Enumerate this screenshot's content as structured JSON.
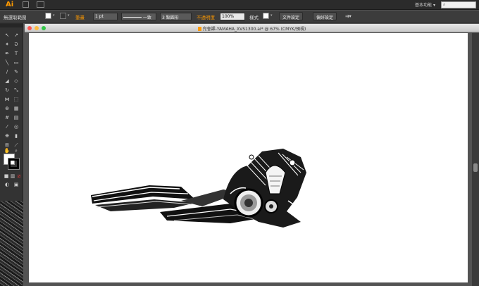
{
  "app": {
    "logo": "Ai",
    "workspace": "基本功能",
    "workspace_chevron": "▾",
    "search_icon": "search-icon"
  },
  "control_bar": {
    "selection_label": "無選取範圍",
    "stroke_label": "筆畫",
    "stroke_weight": "1 pt",
    "stroke_style": "一致",
    "brush": "3 點圓形",
    "opacity_label": "不透明度",
    "opacity_value": "100%",
    "style_label": "樣式",
    "doc_setup_button": "文件設定",
    "preferences_button": "偏好設定"
  },
  "document": {
    "title": "完會課-YAMAHA_XVS1300.ai* @ 67% (CMYK/預視)"
  },
  "colors": {
    "accent": "#ff9a00",
    "close_light": "#fc5753",
    "minimize_light": "#fdbc40",
    "zoom_light": "#33c748"
  }
}
